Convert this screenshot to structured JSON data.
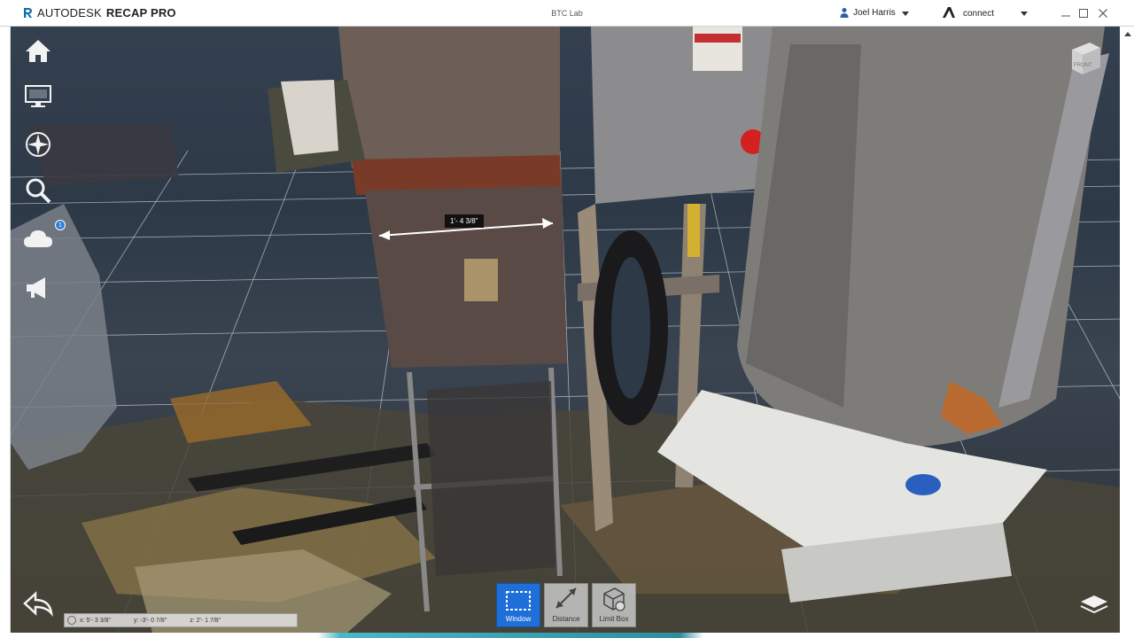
{
  "app": {
    "brand_prefix": "AUTODESK",
    "brand_product": "RECAP PRO",
    "document_title": "BTC Lab",
    "user_name": "Joel Harris",
    "connect_label": "connect"
  },
  "window_controls": [
    "minimize",
    "maximize",
    "close"
  ],
  "left_toolbar": {
    "items": [
      {
        "name": "home",
        "icon": "home-icon"
      },
      {
        "name": "display",
        "icon": "monitor-icon"
      },
      {
        "name": "navigation",
        "icon": "compass-icon"
      },
      {
        "name": "search",
        "icon": "search-icon"
      },
      {
        "name": "cloud",
        "icon": "cloud-icon",
        "badge": "1"
      },
      {
        "name": "announce",
        "icon": "megaphone-icon"
      }
    ]
  },
  "measurement": {
    "label": "1'- 4 3/8\""
  },
  "coordinates": {
    "x": "x: 5'- 3 3/8\"",
    "y": "y: -3'- 0 7/8\"",
    "z": "z: 2'- 1 7/8\""
  },
  "bottom_tools": [
    {
      "label": "Window",
      "icon": "window-select-icon",
      "active": true
    },
    {
      "label": "Distance",
      "icon": "distance-icon",
      "active": false
    },
    {
      "label": "Limit Box",
      "icon": "limit-box-icon",
      "active": false
    }
  ],
  "viewcube": {
    "face_label": "FRONT"
  },
  "colors": {
    "accent": "#1e6fd8",
    "background_sky": "#34404f",
    "measure_line": "#ffffff"
  }
}
